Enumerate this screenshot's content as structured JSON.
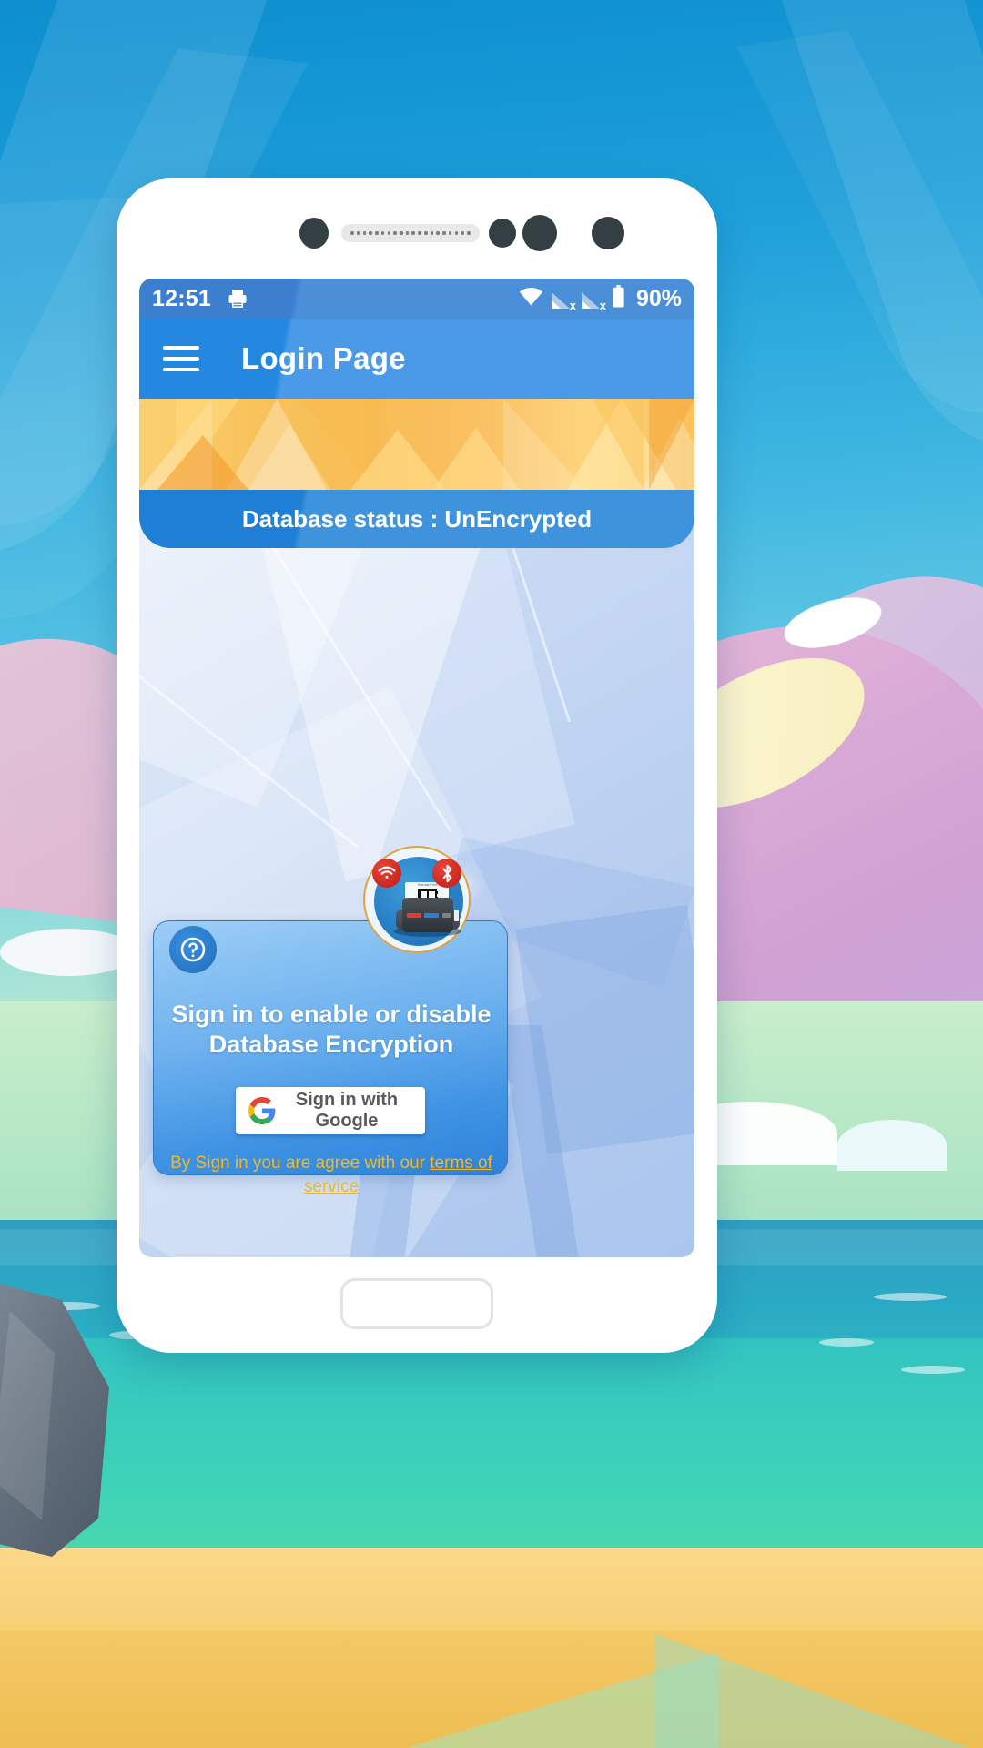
{
  "wallpaper": {
    "description": "beach-scene-wallpaper"
  },
  "device": {
    "sensors": [
      "proximity-sensor",
      "speaker-grille",
      "front-camera",
      "front-camera-lens",
      "indicator-led"
    ],
    "home_button": "home-button"
  },
  "status_bar": {
    "time": "12:51",
    "printer_icon": "printer-icon",
    "wifi_icon": "wifi-icon",
    "signal1_icon": "signal-no-sim-icon",
    "signal1_mark": "x",
    "signal2_icon": "signal-no-sim-icon",
    "signal2_mark": "x",
    "battery_icon": "battery-icon",
    "battery_text": "90%"
  },
  "app_bar": {
    "menu_icon": "hamburger-menu-icon",
    "title": "Login Page"
  },
  "header": {
    "banner_art": "orange-geometric-banner",
    "database_status": "Database status : UnEncrypted"
  },
  "printer_logo": {
    "name": "thermal-printer-logo",
    "wifi_badge": "wifi-badge-icon",
    "bluetooth_badge": "bluetooth-badge-icon",
    "bluetooth_glyph": "ᛦ",
    "receipt_title": "Thermal Print",
    "qr": "qr-code"
  },
  "signin_card": {
    "help_icon": "help-question-icon",
    "help_glyph": "?",
    "heading": "Sign in to enable or disable Database Encryption",
    "google_button_label": "Sign in with Google",
    "google_icon": "google-g-icon",
    "terms_prefix": "By Sign in you are agree with our ",
    "terms_link": "terms of service"
  },
  "colors": {
    "app_bar_blue": "#2487e0",
    "status_bar_blue": "#3b7fce",
    "banner_orange": "#f9c35c",
    "status_strip_blue": "#1f7fd6",
    "card_blue": "#6fb2ef",
    "terms_amber": "#f3b724",
    "badge_red": "#cf2b23",
    "logo_ring_orange": "#e2a23f"
  }
}
